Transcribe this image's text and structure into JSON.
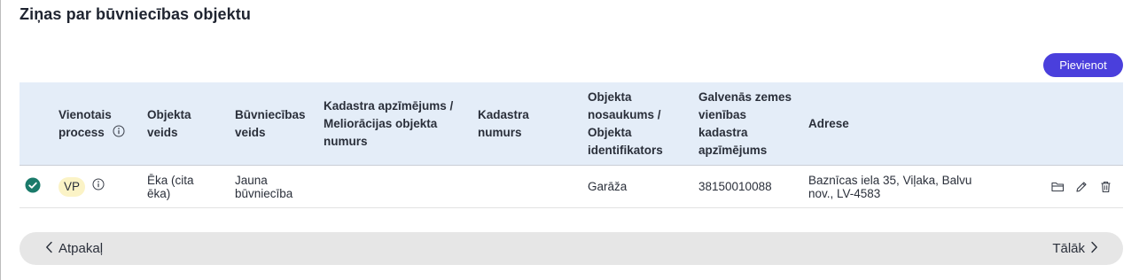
{
  "page": {
    "title": "Ziņas par būvniecības objektu"
  },
  "toolbar": {
    "add_label": "Pievienot"
  },
  "table": {
    "columns": [
      "Vienotais\nprocess",
      "Objekta\nveids",
      "Būvniecības\nveids",
      "Kadastra apzīmējums /\nMeliorācijas objekta\nnumurs",
      "Kadastra\nnumurs",
      "Objekta\nnosaukums /\nObjekta\nidentifikators",
      "Galvenās zemes\nvienības\nkadastra\napzīmējums",
      "Adrese"
    ],
    "rows": [
      {
        "status": "check-circle-icon",
        "process": "VP",
        "object_type": "Ēka (cita\nēka)",
        "construction_type": "Jauna\nbūvniecība",
        "cadastral_designation": "",
        "cadastral_number": "",
        "object_name": "Garāža",
        "main_land_unit": "38150010088",
        "address": "Baznīcas iela 35, Viļaka, Balvu\nnov., LV-4583"
      }
    ]
  },
  "navigation": {
    "back_label": "Atpakaļ",
    "next_label": "Tālāk"
  },
  "colors": {
    "accent": "#4a3fdc",
    "header_bg": "#e4edf8",
    "success": "#1a7a6a",
    "badge": "#fbf3c6",
    "nav_bg": "#e6e6e6"
  }
}
